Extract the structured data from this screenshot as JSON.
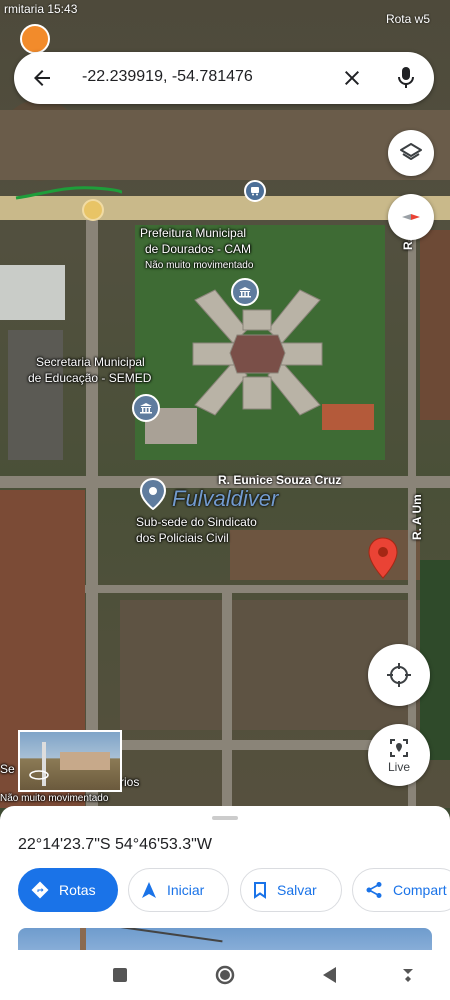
{
  "status_bar": {
    "left_text": "rmitaria 15:43",
    "right_text": "Rota w5"
  },
  "search": {
    "query": "-22.239919, -54.781476",
    "back_icon": "arrow-back-icon",
    "clear_icon": "close-icon",
    "mic_icon": "mic-icon"
  },
  "map": {
    "labels": {
      "prefeitura_line1": "Prefeitura Municipal",
      "prefeitura_line2": "de Dourados - CAM",
      "prefeitura_busy": "Não muito movimentado",
      "secretaria_line1": "Secretaria Municipal",
      "secretaria_line2": "de Educação - SEMED",
      "street_eunice": "R. Eunice Souza Cruz",
      "street_a_um": "R. A Um",
      "street_a_um_2": "R. A Um",
      "sindicato_line1": "Sub-sede do Sindicato",
      "sindicato_line2": "dos Policiais Civil",
      "bottom_left_1": "Se",
      "bottom_left_2": "rios",
      "bottom_busy": "Não muito movimentado",
      "watermark": "Fulvaldiver"
    },
    "buttons": {
      "layers_icon": "layers-icon",
      "compass_icon": "compass-icon",
      "my_location_icon": "my-location-icon",
      "live_label": "Live"
    }
  },
  "sheet": {
    "coordinates": "22°14'23.7\"S 54°46'53.3\"W",
    "actions": [
      {
        "label": "Rotas",
        "icon": "directions-icon"
      },
      {
        "label": "Iniciar",
        "icon": "navigation-icon"
      },
      {
        "label": "Salvar",
        "icon": "bookmark-icon"
      },
      {
        "label": "Compart",
        "icon": "share-icon"
      }
    ]
  },
  "navbar": {
    "recents_icon": "recents-icon",
    "home_icon": "home-icon",
    "back_icon": "back-triangle-icon",
    "extra_icon": "keyboard-down-icon"
  },
  "colors": {
    "accent": "#1a73e8",
    "pin": "#ea4335",
    "road_highlight": "#e8c466"
  }
}
